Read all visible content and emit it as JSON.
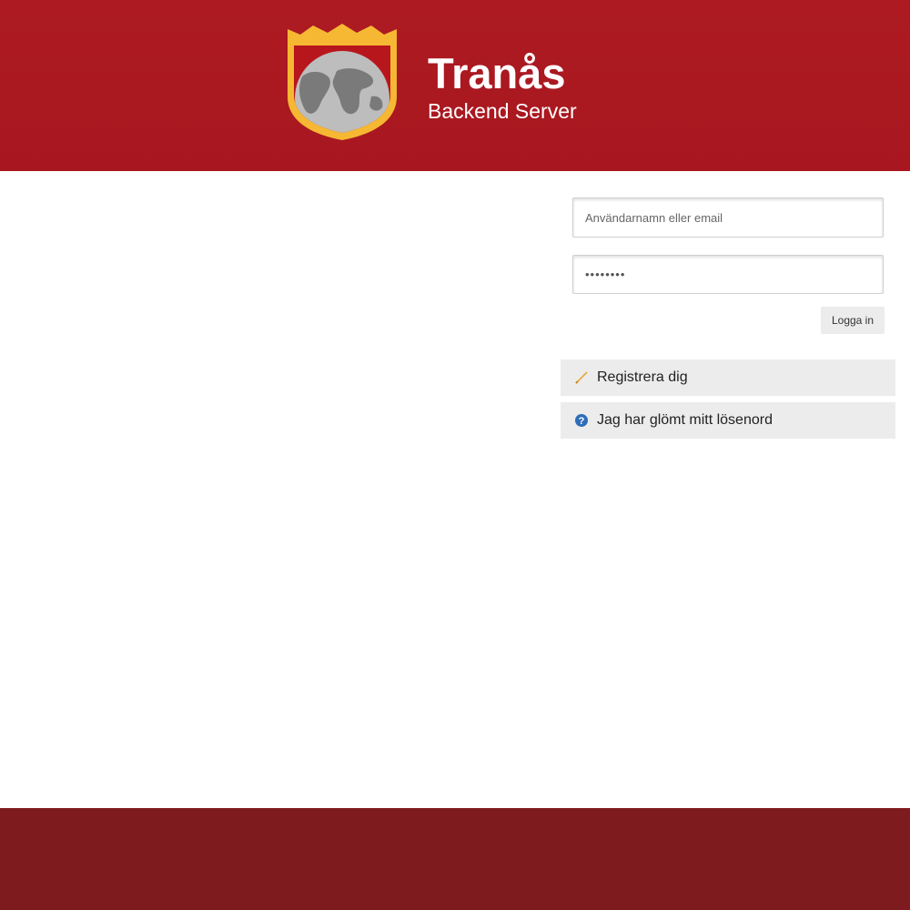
{
  "header": {
    "title": "Tranås",
    "subtitle": "Backend Server"
  },
  "login": {
    "username_placeholder": "Användarnamn eller email",
    "password_value": "••••••••",
    "submit_label": "Logga in"
  },
  "links": {
    "register_label": "Registrera dig",
    "forgot_label": "Jag har glömt mitt lösenord"
  },
  "colors": {
    "header_bg": "#ad1a22",
    "footer_bg": "#7e1b1e",
    "shield_gold": "#f6b833",
    "help_icon_blue": "#2f6db8"
  },
  "icons": {
    "logo": "shield-globe-crown-icon",
    "register": "pencil-icon",
    "forgot": "question-circle-icon"
  }
}
